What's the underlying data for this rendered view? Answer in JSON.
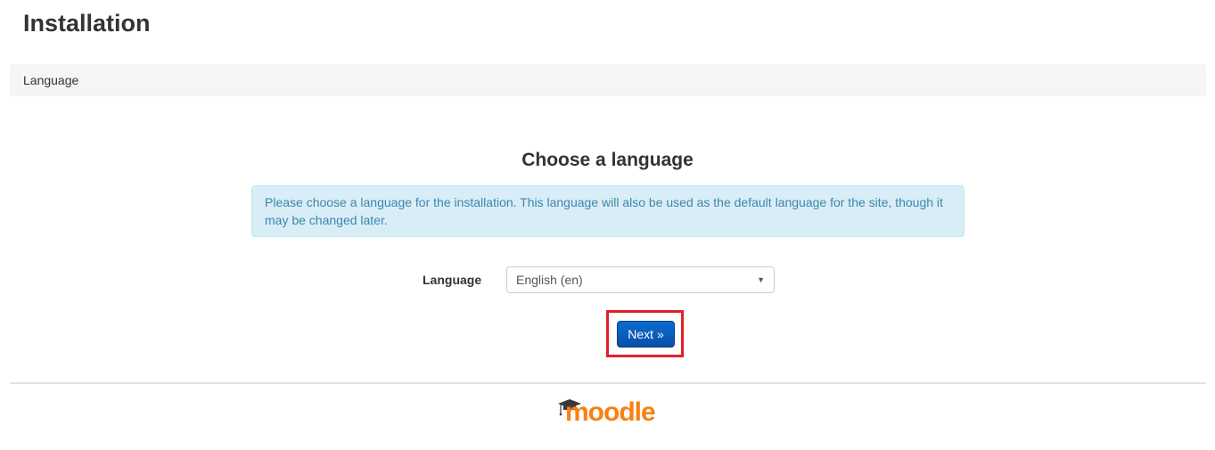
{
  "page": {
    "title": "Installation"
  },
  "breadcrumb": {
    "label": "Language"
  },
  "main": {
    "heading": "Choose a language",
    "info": "Please choose a language for the installation. This language will also be used as the default language for the site, though it may be changed later.",
    "language_label": "Language",
    "language_selected": "English (en)",
    "next_label": "Next »"
  },
  "footer": {
    "logo_text": "moodle",
    "logo_color": "#f98012"
  },
  "colors": {
    "info_bg": "#d9edf7",
    "info_text": "#3a87ad",
    "button": "#0a5cbf",
    "highlight": "#e0202a"
  }
}
